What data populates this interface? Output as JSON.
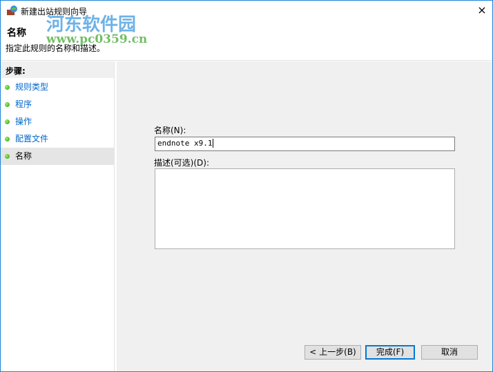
{
  "window": {
    "title": "新建出站规则向导",
    "close_icon": "×"
  },
  "header": {
    "title": "名称",
    "description": "指定此规则的名称和描述。"
  },
  "watermark": {
    "text": "河东软件园",
    "url": "www.pc0359.cn"
  },
  "steps": {
    "heading": "步骤:",
    "items": [
      {
        "label": "规则类型"
      },
      {
        "label": "程序"
      },
      {
        "label": "操作"
      },
      {
        "label": "配置文件"
      },
      {
        "label": "名称"
      }
    ]
  },
  "form": {
    "name_label": "名称(N):",
    "name_value": "endnote x9.1",
    "desc_label": "描述(可选)(D):",
    "desc_value": ""
  },
  "buttons": {
    "back": "< 上一步(B)",
    "finish": "完成(F)",
    "cancel": "取消"
  }
}
